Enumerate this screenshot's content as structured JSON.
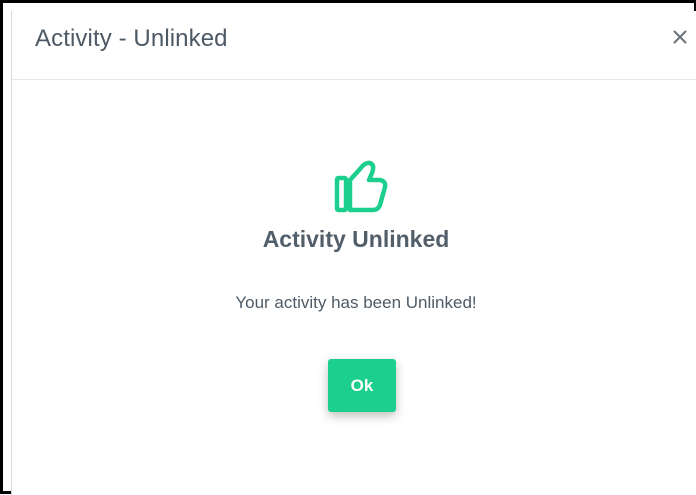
{
  "dialog": {
    "title": "Activity - Unlinked",
    "close_icon": "close-icon"
  },
  "body": {
    "icon": "thumbs-up-icon",
    "heading": "Activity Unlinked",
    "message": "Your activity has been Unlinked!",
    "ok_label": "Ok"
  },
  "colors": {
    "accent": "#1dcf8f",
    "text": "#4d5965",
    "header_border": "#e3e6ea"
  }
}
